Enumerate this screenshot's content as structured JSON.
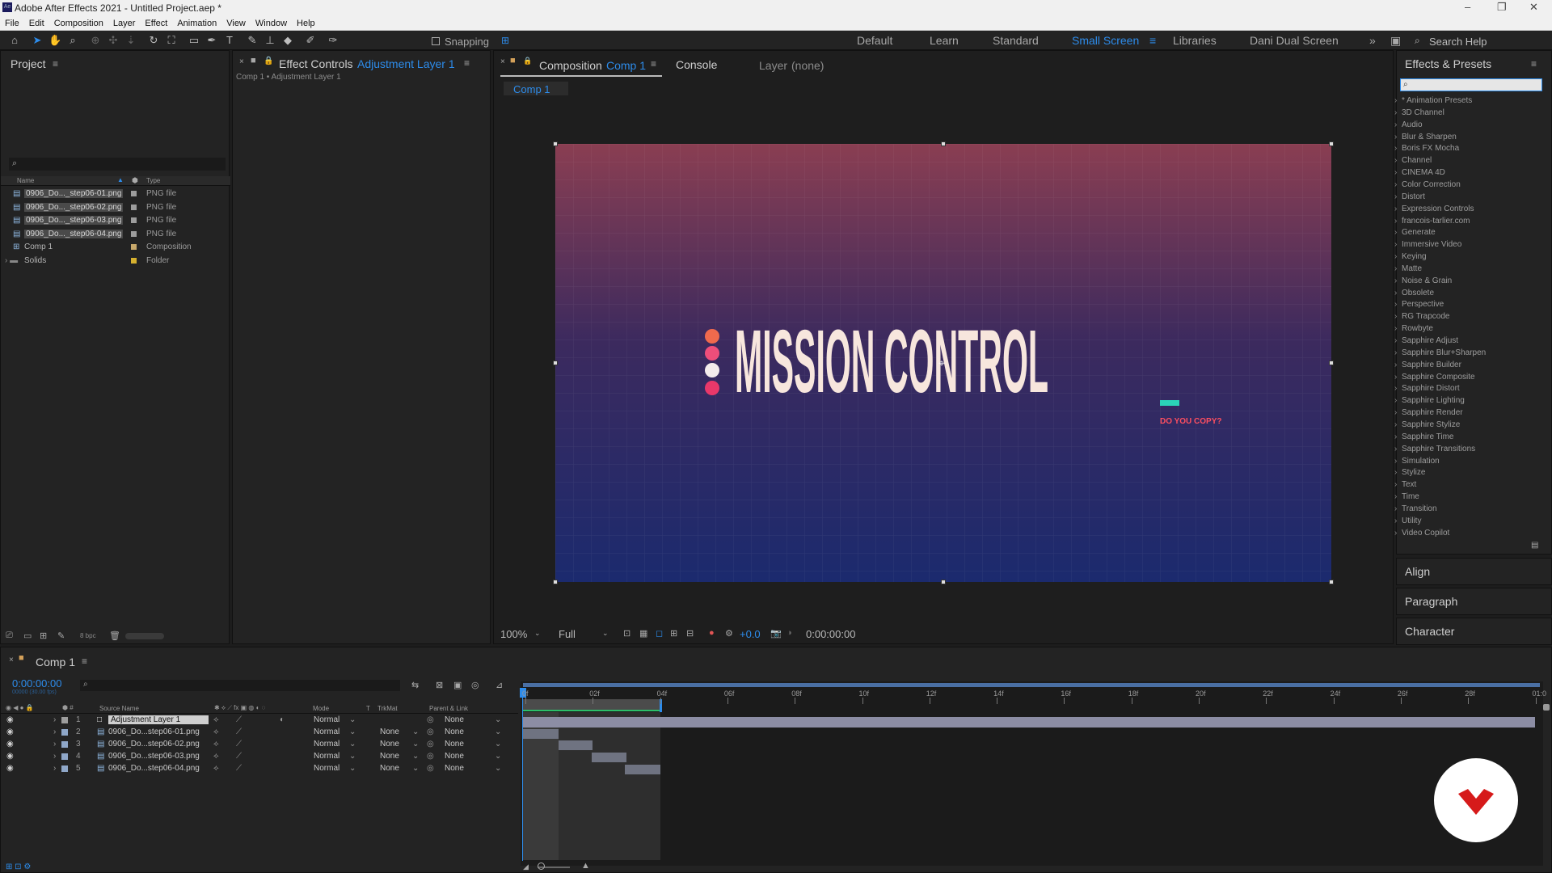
{
  "app": {
    "title": "Adobe After Effects 2021 - Untitled Project.aep *",
    "window_controls": [
      "–",
      "❐",
      "✕"
    ]
  },
  "menu": [
    "File",
    "Edit",
    "Composition",
    "Layer",
    "Effect",
    "Animation",
    "View",
    "Window",
    "Help"
  ],
  "toolbar": {
    "snapping_label": "Snapping",
    "workspaces": [
      "Default",
      "Learn",
      "Standard",
      "Small Screen",
      "Libraries",
      "Dani Dual Screen"
    ],
    "active_workspace": "Small Screen",
    "search_placeholder": "Search Help"
  },
  "project_panel": {
    "title": "Project",
    "columns": [
      "Name",
      "Type"
    ],
    "items": [
      {
        "name": "0906_Do..._step06-01.png",
        "type": "PNG file"
      },
      {
        "name": "0906_Do..._step06-02.png",
        "type": "PNG file"
      },
      {
        "name": "0906_Do..._step06-03.png",
        "type": "PNG file"
      },
      {
        "name": "0906_Do..._step06-04.png",
        "type": "PNG file"
      },
      {
        "name": "Comp 1",
        "type": "Composition"
      },
      {
        "name": "Solids",
        "type": "Folder"
      }
    ],
    "bpc_label": "8 bpc"
  },
  "effect_controls": {
    "title": "Effect Controls",
    "layer": "Adjustment Layer 1",
    "breadcrumb": "Comp 1 • Adjustment Layer 1"
  },
  "composition_panel": {
    "title": "Composition",
    "comp": "Comp 1",
    "console_tab": "Console",
    "layer_tab": "Layer",
    "layer_tab_value": "(none)",
    "comp_tab": "Comp 1",
    "main_text": "MISSION CONTROL",
    "sub_text": "DO YOU COPY?",
    "zoom": "100%",
    "quality": "Full",
    "exposure": "+0.0",
    "timecode": "0:00:00:00",
    "colors": {
      "grad_top": "#8a3e52",
      "grad_mid": "#3c2a5e",
      "grad_bottom": "#1b2a6e",
      "dot1": "#f06a4d",
      "dot2": "#ee4e7a",
      "dot3": "#f4ecec",
      "dot4": "#e8386a",
      "accent_bar": "#2bd3b8",
      "sub_text": "#ff4f60",
      "title": "#f7e6dd"
    }
  },
  "effects_presets": {
    "title": "Effects & Presets",
    "categories": [
      "* Animation Presets",
      "3D Channel",
      "Audio",
      "Blur & Sharpen",
      "Boris FX Mocha",
      "Channel",
      "CINEMA 4D",
      "Color Correction",
      "Distort",
      "Expression Controls",
      "francois-tarlier.com",
      "Generate",
      "Immersive Video",
      "Keying",
      "Matte",
      "Noise & Grain",
      "Obsolete",
      "Perspective",
      "RG Trapcode",
      "Rowbyte",
      "Sapphire Adjust",
      "Sapphire Blur+Sharpen",
      "Sapphire Builder",
      "Sapphire Composite",
      "Sapphire Distort",
      "Sapphire Lighting",
      "Sapphire Render",
      "Sapphire Stylize",
      "Sapphire Time",
      "Sapphire Transitions",
      "Simulation",
      "Stylize",
      "Text",
      "Time",
      "Transition",
      "Utility",
      "Video Copilot"
    ],
    "collapsed_panels": [
      "Align",
      "Paragraph",
      "Character"
    ]
  },
  "timeline": {
    "title": "Comp 1",
    "timecode": "0:00:00:00",
    "fps_label": "00000 (30.00 fps)",
    "columns": {
      "source": "Source Name",
      "mode": "Mode",
      "t": "T",
      "trkmat": "TrkMat",
      "parent": "Parent & Link"
    },
    "layers": [
      {
        "num": "1",
        "name": "Adjustment Layer 1",
        "mode": "Normal",
        "trkmat": "",
        "parent": "None"
      },
      {
        "num": "2",
        "name": "0906_Do...step06-01.png",
        "mode": "Normal",
        "trkmat": "None",
        "parent": "None"
      },
      {
        "num": "3",
        "name": "0906_Do...step06-02.png",
        "mode": "Normal",
        "trkmat": "None",
        "parent": "None"
      },
      {
        "num": "4",
        "name": "0906_Do...step06-03.png",
        "mode": "Normal",
        "trkmat": "None",
        "parent": "None"
      },
      {
        "num": "5",
        "name": "0906_Do...step06-04.png",
        "mode": "Normal",
        "trkmat": "None",
        "parent": "None"
      }
    ],
    "ruler": [
      "0f",
      "02f",
      "04f",
      "06f",
      "08f",
      "10f",
      "12f",
      "14f",
      "16f",
      "18f",
      "20f",
      "22f",
      "24f",
      "26f",
      "28f",
      "01:0"
    ]
  }
}
